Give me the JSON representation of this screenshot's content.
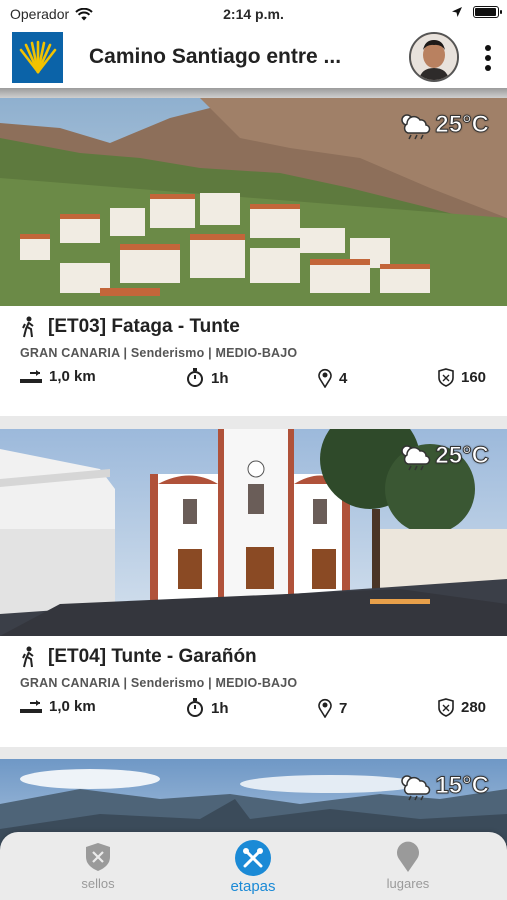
{
  "status_bar": {
    "carrier": "Operador",
    "time": "2:14 p.m."
  },
  "header": {
    "title": "Camino Santiago entre ..."
  },
  "cards": [
    {
      "title": "[ET03] Fataga -  Tunte",
      "subtitle": "GRAN CANARIA  |  Senderismo  |  MEDIO-BAJO",
      "distance": "1,0 km",
      "duration": "1h",
      "points": "4",
      "score": "160",
      "weather_temp": "25°C",
      "weather_icon": "cloud-rain-sun-icon"
    },
    {
      "title": "[ET04] Tunte - Garañón",
      "subtitle": "GRAN CANARIA  |  Senderismo  |  MEDIO-BAJO",
      "distance": "1,0 km",
      "duration": "1h",
      "points": "7",
      "score": "280",
      "weather_temp": "25°C",
      "weather_icon": "cloud-rain-sun-icon"
    },
    {
      "weather_temp": "15°C",
      "weather_icon": "cloud-rain-sun-icon"
    }
  ],
  "tabbar": {
    "tabs": [
      {
        "label": "sellos",
        "icon": "shield-icon",
        "active": false
      },
      {
        "label": "etapas",
        "icon": "crossed-tools-icon",
        "active": true
      },
      {
        "label": "lugares",
        "icon": "map-pin-icon",
        "active": false
      }
    ]
  },
  "colors": {
    "accent": "#1b8ad6",
    "logo_bg": "#0b63a8",
    "logo_shell": "#f2c200"
  }
}
